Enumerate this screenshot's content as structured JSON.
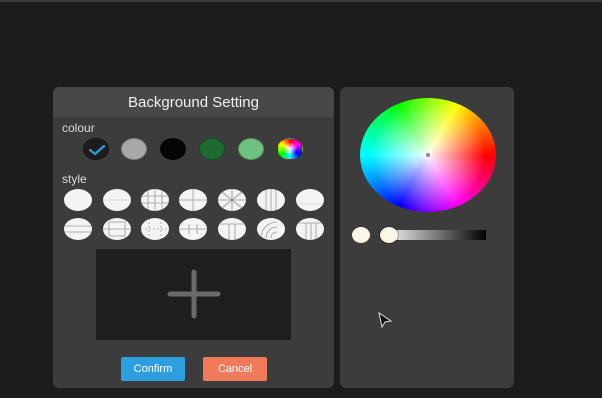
{
  "dialog": {
    "title": "Background Setting",
    "colour_label": "colour",
    "style_label": "style",
    "colour_swatches": [
      {
        "name": "dark",
        "color": "#1c1c1c",
        "selected": true
      },
      {
        "name": "gray",
        "color": "#a8a8a8",
        "selected": false
      },
      {
        "name": "black",
        "color": "#050505",
        "selected": false
      },
      {
        "name": "dark-green",
        "color": "#1d6b30",
        "selected": false
      },
      {
        "name": "light-green",
        "color": "#6ec17e",
        "selected": false
      },
      {
        "name": "rainbow",
        "color": "custom",
        "selected": false
      }
    ],
    "check_color": "#2d9fe0",
    "style_count": 14,
    "confirm_label": "Confirm",
    "cancel_label": "Cancel",
    "confirm_color": "#2d9fe0",
    "cancel_color": "#f07a5a"
  },
  "picker": {
    "current_color": "#fbf6e8",
    "brightness_fraction": 0
  }
}
